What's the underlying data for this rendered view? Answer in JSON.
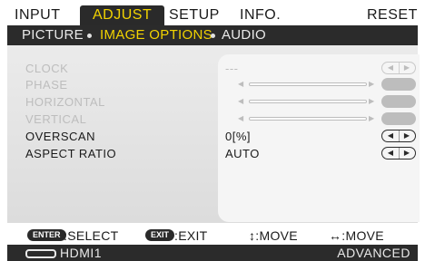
{
  "tabs": [
    "INPUT",
    "ADJUST",
    "SETUP",
    "INFO.",
    "RESET"
  ],
  "breadcrumb": {
    "first": "PICTURE",
    "active": "IMAGE OPTIONS",
    "last": "AUDIO"
  },
  "items": [
    {
      "label": "CLOCK",
      "value": "---",
      "enabled": false
    },
    {
      "label": "PHASE",
      "enabled": false
    },
    {
      "label": "HORIZONTAL",
      "enabled": false
    },
    {
      "label": "VERTICAL",
      "enabled": false
    },
    {
      "label": "OVERSCAN",
      "value": "0[%]",
      "enabled": true
    },
    {
      "label": "ASPECT RATIO",
      "value": "AUTO",
      "enabled": true
    }
  ],
  "footer": {
    "enter_key": "ENTER",
    "enter_label": ":SELECT",
    "exit_key": "EXIT",
    "exit_label": ":EXIT",
    "move_v": "↕:MOVE",
    "move_h": "↔:MOVE"
  },
  "status": {
    "source": "HDMI1",
    "mode": "ADVANCED"
  },
  "colors": {
    "accent": "#f2d300",
    "bar": "#2b2b2b",
    "disabled": "#bdbdbd"
  }
}
